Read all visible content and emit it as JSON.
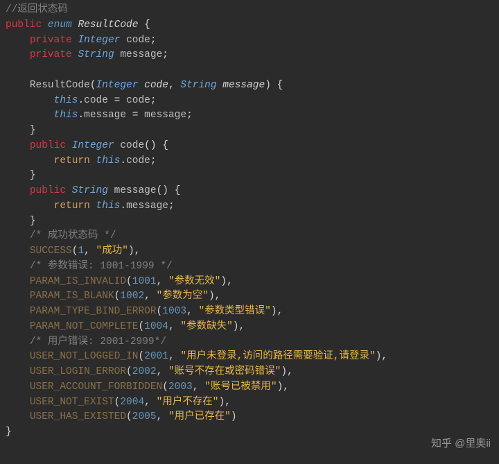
{
  "c1": "//返回状态码",
  "kw_public": "public",
  "kw_enum": "enum",
  "class_name": "ResultCode",
  "kw_private": "private",
  "t_integer": "Integer",
  "t_string": "String",
  "f_code": "code",
  "f_message": "message",
  "ctor": "ResultCode",
  "p_code": "code",
  "p_message": "message",
  "kw_this": "this",
  "kw_return": "return",
  "c_success": "/* 成功状态码 */",
  "c_param": "/* 参数错误: 1001-1999 */",
  "c_user": "/* 用户错误: 2001-2999*/",
  "e_SUCCESS": "SUCCESS",
  "e_SUCCESS_n": "1",
  "e_SUCCESS_s": "\"成功\"",
  "e_PII": "PARAM_IS_INVALID",
  "e_PII_n": "1001",
  "e_PII_s": "\"参数无效\"",
  "e_PIB": "PARAM_IS_BLANK",
  "e_PIB_n": "1002",
  "e_PIB_s": "\"参数为空\"",
  "e_PTBE": "PARAM_TYPE_BIND_ERROR",
  "e_PTBE_n": "1003",
  "e_PTBE_s": "\"参数类型错误\"",
  "e_PNC": "PARAM_NOT_COMPLETE",
  "e_PNC_n": "1004",
  "e_PNC_s": "\"参数缺失\"",
  "e_UNLI": "USER_NOT_LOGGED_IN",
  "e_UNLI_n": "2001",
  "e_UNLI_s": "\"用户未登录,访问的路径需要验证,请登录\"",
  "e_ULE": "USER_LOGIN_ERROR",
  "e_ULE_n": "2002",
  "e_ULE_s": "\"账号不存在或密码错误\"",
  "e_UAF": "USER_ACCOUNT_FORBIDDEN",
  "e_UAF_n": "2003",
  "e_UAF_s": "\"账号已被禁用\"",
  "e_UNE": "USER_NOT_EXIST",
  "e_UNE_n": "2004",
  "e_UNE_s": "\"用户不存在\"",
  "e_UHE": "USER_HAS_EXISTED",
  "e_UHE_n": "2005",
  "e_UHE_s": "\"用户已存在\"",
  "watermark": "知乎 @里奥ii"
}
